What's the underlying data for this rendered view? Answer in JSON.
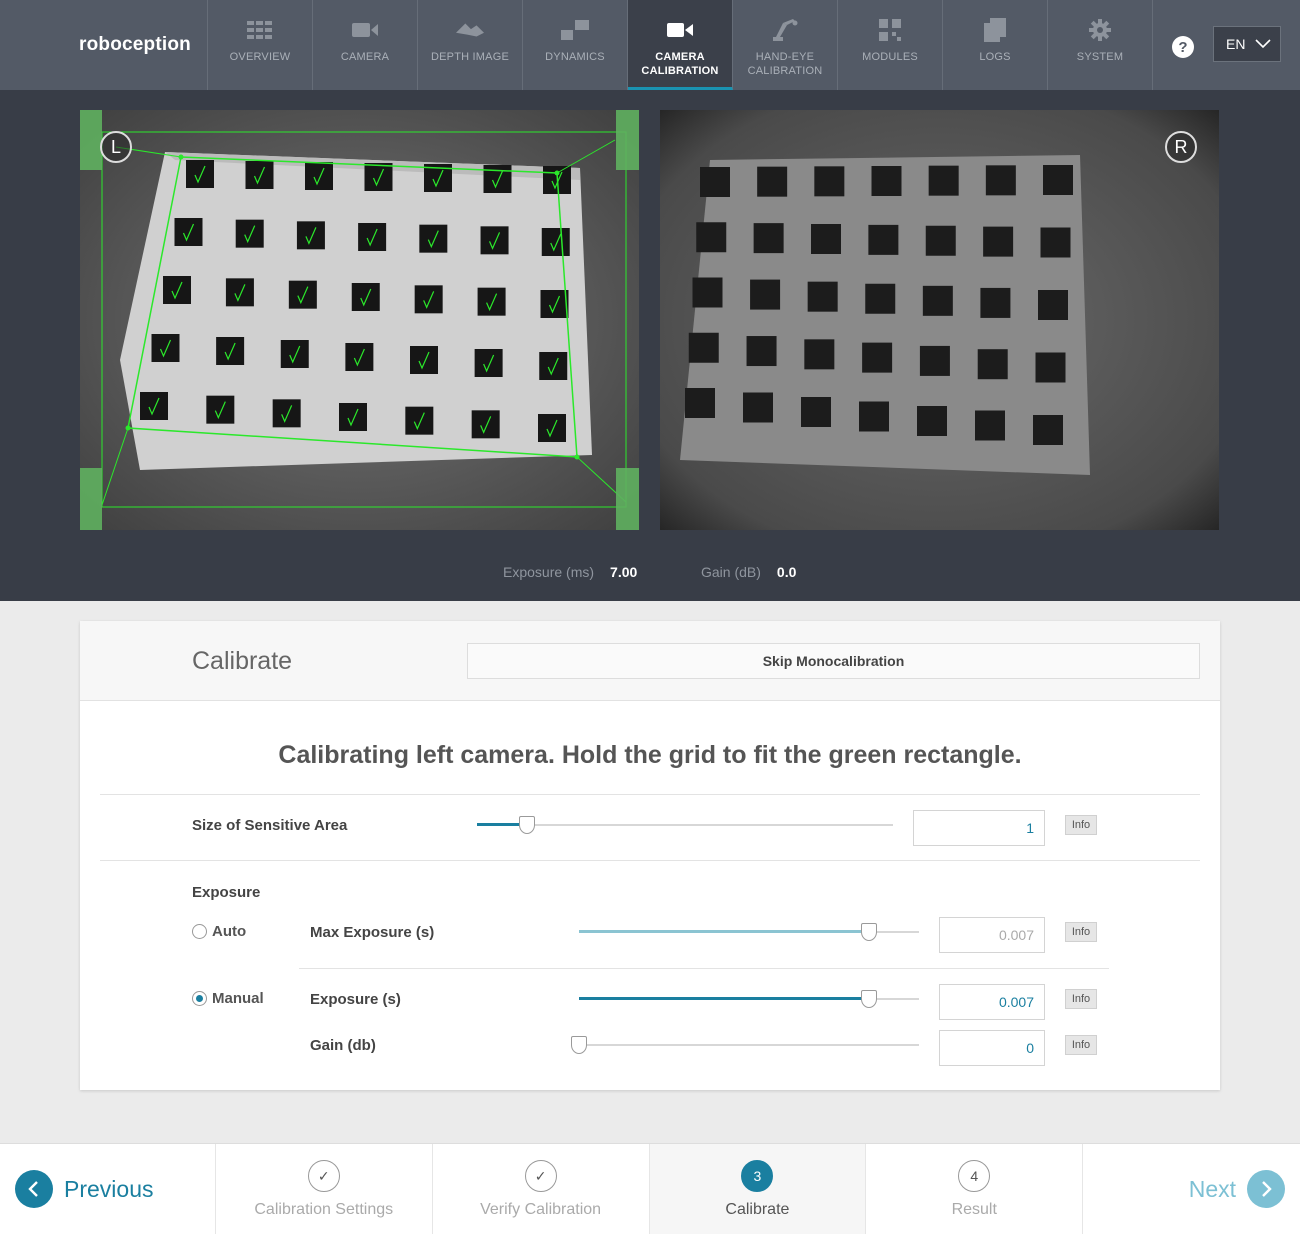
{
  "brand": {
    "logo_text": "roboception"
  },
  "nav": {
    "items": [
      {
        "label": "OVERVIEW",
        "icon": "grid-icon"
      },
      {
        "label": "CAMERA",
        "icon": "camera-icon"
      },
      {
        "label": "DEPTH IMAGE",
        "icon": "depth-image-icon"
      },
      {
        "label": "DYNAMICS",
        "icon": "dynamics-icon"
      },
      {
        "label": "CAMERA CALIBRATION",
        "icon": "video-camera-icon",
        "active": true
      },
      {
        "label": "HAND-EYE CALIBRATION",
        "icon": "robot-arm-icon"
      },
      {
        "label": "MODULES",
        "icon": "qr-code-icon"
      },
      {
        "label": "LOGS",
        "icon": "documents-icon"
      },
      {
        "label": "SYSTEM",
        "icon": "gear-icon"
      }
    ],
    "help_icon": "?",
    "language": "EN"
  },
  "cameras": {
    "left_badge": "L",
    "right_badge": "R",
    "exposure_label": "Exposure (ms)",
    "exposure_value": "7.00",
    "gain_label": "Gain (dB)",
    "gain_value": "0.0"
  },
  "panel": {
    "title": "Calibrate",
    "skip_button": "Skip Monocalibration",
    "instruction": "Calibrating left camera. Hold the grid to fit the green rectangle.",
    "sensitive_area": {
      "label": "Size of Sensitive Area",
      "value": "1",
      "slider_fraction": 0.1,
      "info": "Info"
    },
    "exposure_section": "Exposure",
    "auto_label": "Auto",
    "manual_label": "Manual",
    "max_exposure": {
      "label": "Max Exposure (s)",
      "value": "0.007",
      "slider_fraction": 0.83,
      "info": "Info"
    },
    "exposure": {
      "label": "Exposure (s)",
      "value": "0.007",
      "slider_fraction": 0.83,
      "info": "Info"
    },
    "gain": {
      "label": "Gain (db)",
      "value": "0",
      "slider_fraction": 0.0,
      "info": "Info"
    },
    "mode": "Manual"
  },
  "wizard": {
    "previous": "Previous",
    "next": "Next",
    "steps": [
      {
        "num": "✓",
        "label": "Calibration Settings",
        "state": "done"
      },
      {
        "num": "✓",
        "label": "Verify Calibration",
        "state": "done"
      },
      {
        "num": "3",
        "label": "Calibrate",
        "state": "active"
      },
      {
        "num": "4",
        "label": "Result",
        "state": "todo"
      }
    ]
  },
  "colors": {
    "accent": "#1a7fa0",
    "detect_green": "#2be82b",
    "nav_bg": "#535a66"
  }
}
